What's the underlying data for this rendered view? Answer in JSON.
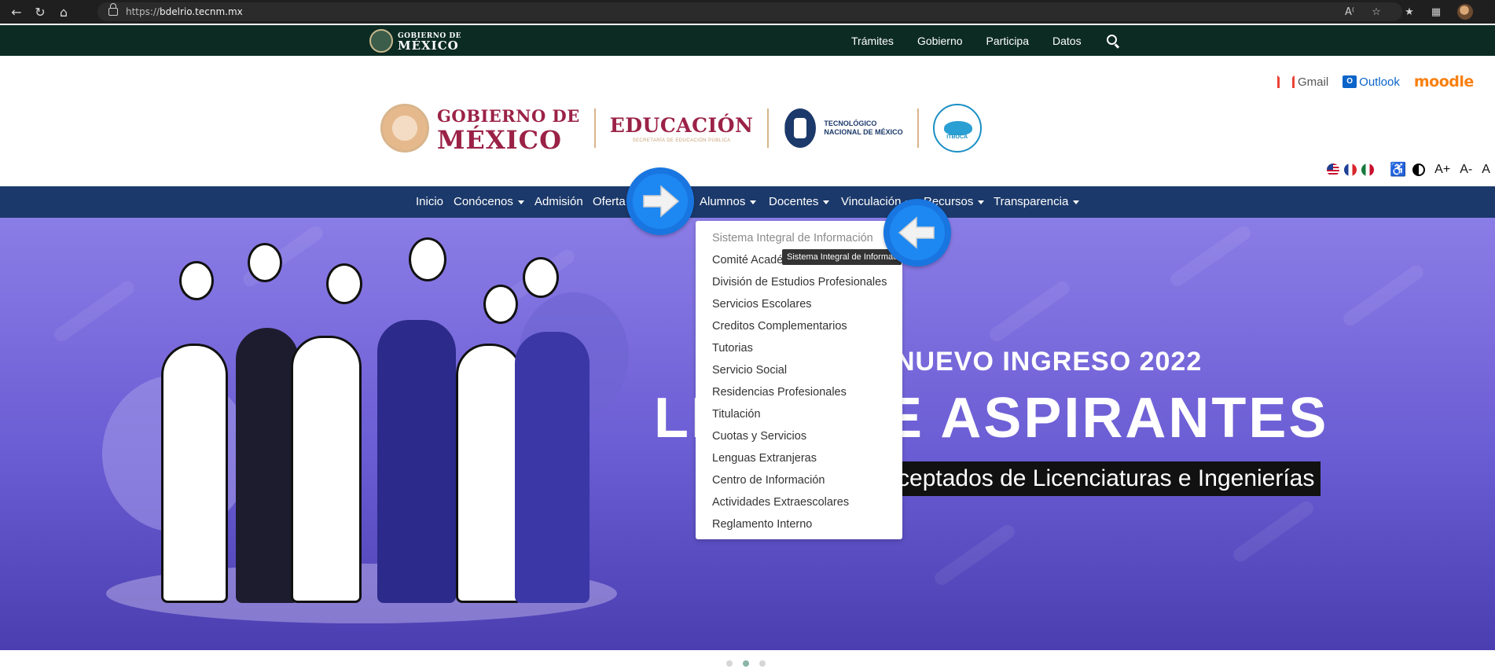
{
  "browser": {
    "url_prefix": "https://",
    "url_host": "bdelrio.tecnm.mx"
  },
  "gob_bar": {
    "logo_line1": "GOBIERNO DE",
    "logo_line2": "MÉXICO",
    "links": [
      "Trámites",
      "Gobierno",
      "Participa",
      "Datos"
    ]
  },
  "header": {
    "mail_links": {
      "gmail": "Gmail",
      "outlook": "Outlook",
      "moodle": "moodle"
    },
    "gobierno_logo": {
      "line1": "GOBIERNO DE",
      "line2": "MÉXICO"
    },
    "educacion_logo": {
      "title": "EDUCACIÓN",
      "subtitle": "SECRETARÍA DE EDUCACIÓN PÚBLICA"
    },
    "tecnm_logo": {
      "line1": "TECNOLÓGICO",
      "line2": "NACIONAL DE MÉXICO"
    },
    "itboca_logo": "ITBOCA",
    "font_controls": [
      "A+",
      "A-",
      "A"
    ]
  },
  "nav": {
    "items": [
      "Inicio",
      "Conócenos",
      "Admisión",
      "Oferta",
      "Alumnos",
      "Docentes",
      "Vinculación",
      "Recursos",
      "Transparencia"
    ]
  },
  "dropdown": {
    "items": [
      "Sistema Integral de Información",
      "Comité Académico",
      "División de Estudios Profesionales",
      "Servicios Escolares",
      "Creditos Complementarios",
      "Tutorias",
      "Servicio Social",
      "Residencias Profesionales",
      "Titulación",
      "Cuotas y Servicios",
      "Lenguas Extranjeras",
      "Centro de Información",
      "Actividades Extraescolares",
      "Reglamento Interno"
    ],
    "tooltip": "Sistema Integral de Información"
  },
  "hero": {
    "title1": "NUEVO INGRESO 2022",
    "title2": "LISTA DE ASPIRANTES",
    "subtitle": "Aceptados de Licenciaturas e Ingenierías"
  },
  "carousel": {
    "count": 3,
    "active_index": 1
  },
  "colors": {
    "gob_bar": "#0c2b23",
    "nav": "#1b396a",
    "gobierno_red": "#9b2247",
    "arrow_blue": "#1e88f2"
  }
}
